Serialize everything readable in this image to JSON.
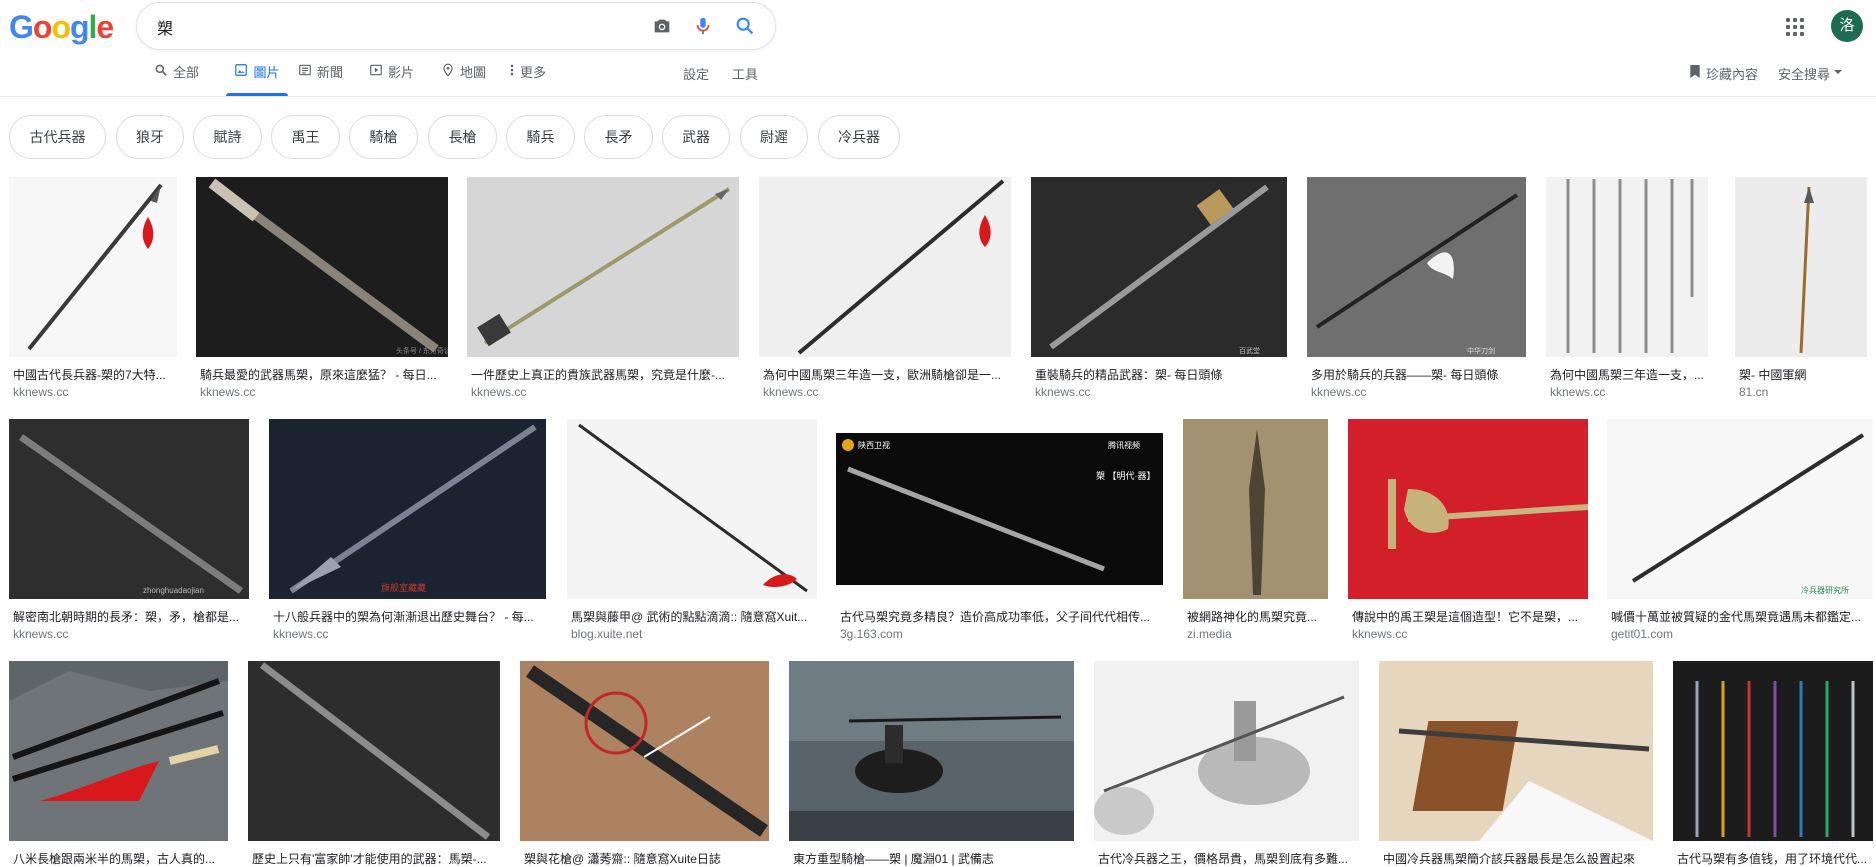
{
  "logo": [
    "G",
    "o",
    "o",
    "g",
    "l",
    "e"
  ],
  "search": {
    "query": "槊"
  },
  "tabs": [
    {
      "label": "全部",
      "icon": "search-icon"
    },
    {
      "label": "圖片",
      "icon": "image-icon"
    },
    {
      "label": "新聞",
      "icon": "news-icon"
    },
    {
      "label": "影片",
      "icon": "video-icon"
    },
    {
      "label": "地圖",
      "icon": "map-pin-icon"
    },
    {
      "label": "更多",
      "icon": "more-vert-icon"
    }
  ],
  "tools": {
    "settings": "設定",
    "tools": "工具",
    "saved": "珍藏內容",
    "safesearch": "安全搜尋"
  },
  "avatar": "洛",
  "chips": [
    "古代兵器",
    "狼牙",
    "賦詩",
    "禹王",
    "騎槍",
    "長槍",
    "騎兵",
    "長矛",
    "武器",
    "尉遲",
    "冷兵器"
  ],
  "results": [
    {
      "caption": "中國古代長兵器-槊的7大特...",
      "source": "kknews.cc"
    },
    {
      "caption": "騎兵最愛的武器馬槊，原來這麼猛？ - 每日...",
      "source": "kknews.cc"
    },
    {
      "caption": "一件歷史上真正的貴族武器馬槊，究竟是什麼-...",
      "source": "kknews.cc"
    },
    {
      "caption": "為何中國馬槊三年造一支，歐洲騎槍卻是一...",
      "source": "kknews.cc"
    },
    {
      "caption": "重裝騎兵的精品武器：槊- 每日頭條",
      "source": "kknews.cc"
    },
    {
      "caption": "多用於騎兵的兵器——槊- 每日頭條",
      "source": "kknews.cc"
    },
    {
      "caption": "為何中國馬槊三年造一支，...",
      "source": "kknews.cc"
    },
    {
      "caption": "槊- 中國軍網",
      "source": "81.cn"
    },
    {
      "caption": "解密南北朝時期的長矛：槊，矛，槍都是...",
      "source": "kknews.cc"
    },
    {
      "caption": "十八般兵器中的槊為何漸漸退出歷史舞台？ - 每...",
      "source": "kknews.cc"
    },
    {
      "caption": "馬槊與藤甲@ 武術的點點滴滴:: 隨意窩Xuit...",
      "source": "blog.xuite.net"
    },
    {
      "caption": "古代马槊究竟多精良？造价高成功率低，父子间代代相传...",
      "source": "3g.163.com"
    },
    {
      "caption": "被網路神化的馬槊究竟...",
      "source": "zi.media"
    },
    {
      "caption": "傳說中的禹王槊是這個造型！它不是槊，...",
      "source": "kknews.cc"
    },
    {
      "caption": "喊價十萬並被質疑的金代馬槊竟遇馬未都鑑定...",
      "source": "getit01.com"
    },
    {
      "caption": "八米長槍跟兩米半的馬槊，古人真的...",
      "source": ""
    },
    {
      "caption": "歷史上只有'富家帥'才能使用的武器：馬槊-...",
      "source": ""
    },
    {
      "caption": "槊與花槍@ 瀟莠齋:: 隨意窩Xuite日誌",
      "source": ""
    },
    {
      "caption": "東方重型騎槍——槊 | 魔淵01 | 武備志",
      "source": ""
    },
    {
      "caption": "古代冷兵器之王，價格昂貴，馬槊到底有多難...",
      "source": ""
    },
    {
      "caption": "中國冷兵器馬槊簡介該兵器最長是怎么設置起來",
      "source": ""
    },
    {
      "caption": "古代马槊有多值钱，用了环境代代...",
      "source": ""
    }
  ],
  "watermarks": {
    "w1": "头条号 / 东方奇谈",
    "w2": "zhonghuadaojian",
    "w3": "腾讯视频",
    "w4": "陕西卫视",
    "w5": "槊 【明代·器】",
    "w6": "中华刀剑",
    "w7": "百武堂",
    "w8": "冷兵器研究所",
    "w9": "头条号 / 冷兵器研究",
    "w10": "旗舰室藏藏"
  },
  "colors": {
    "blue": "#4285F4",
    "red": "#EA4335",
    "yellow": "#FBBC05",
    "green": "#34A853",
    "accent": "#1a73e8"
  }
}
